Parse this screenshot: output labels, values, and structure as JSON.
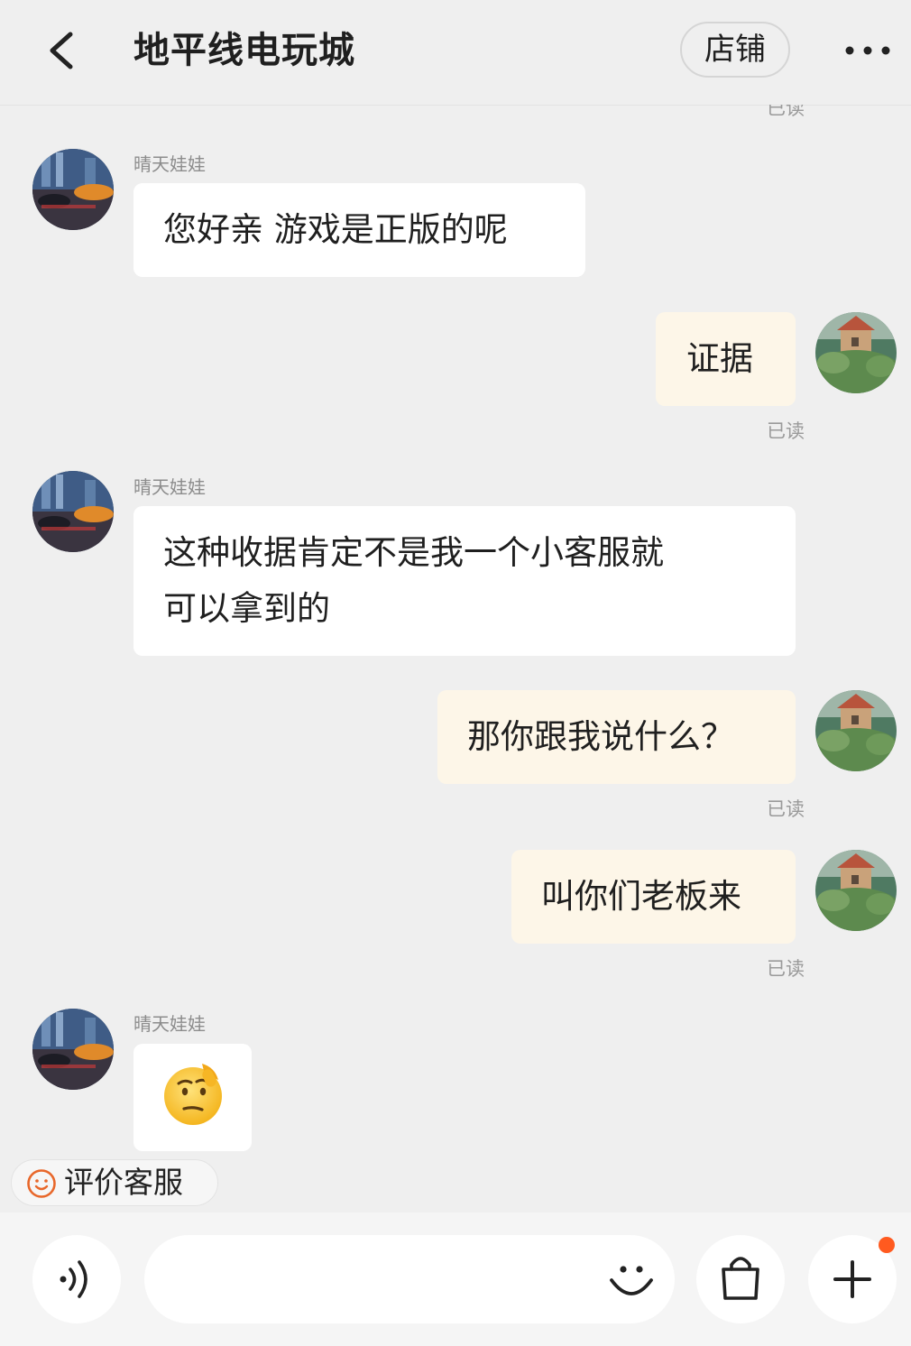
{
  "header": {
    "title": "地平线电玩城",
    "store_label": "店铺"
  },
  "agent_name": "晴天娃娃",
  "read_label": "已读",
  "messages": [
    {
      "side": "in",
      "text": "您好亲  游戏是正版的呢"
    },
    {
      "side": "out",
      "text": "证据"
    },
    {
      "side": "in",
      "text_line1": "这种收据肯定不是我一个小客服就",
      "text_line2": "可以拿到的"
    },
    {
      "side": "out",
      "text": "那你跟我说什么？"
    },
    {
      "side": "out",
      "text": "叫你们老板来"
    },
    {
      "side": "in",
      "emoji": "thinking-face-emoji"
    }
  ],
  "rate_chip": {
    "label": "评价客服"
  },
  "input": {
    "placeholder": ""
  },
  "icons": [
    "back-arrow-icon",
    "more-dots-icon",
    "voice-icon",
    "emoji-icon",
    "shopping-bag-icon",
    "plus-icon",
    "smile-icon"
  ],
  "colors": {
    "background": "#efefef",
    "incoming_bubble": "#ffffff",
    "outgoing_bubble": "#fdf6e8",
    "accent": "#ff5a1f",
    "read_text": "#9a9a9a"
  }
}
